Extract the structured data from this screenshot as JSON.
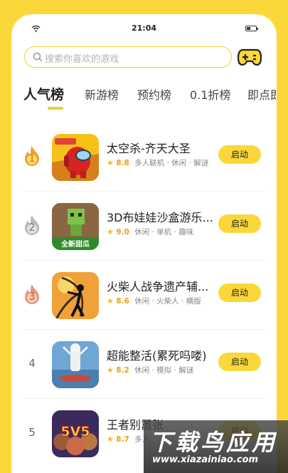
{
  "status": {
    "time": "21:04"
  },
  "search": {
    "placeholder": "搜索你喜欢的游戏"
  },
  "tabs": [
    {
      "label": "人气榜",
      "active": true
    },
    {
      "label": "新游榜"
    },
    {
      "label": "预约榜"
    },
    {
      "label": "0.1折榜"
    },
    {
      "label": "即点即"
    }
  ],
  "games": [
    {
      "rank": "1",
      "title": "太空杀-齐天大圣",
      "rating": "8.8",
      "tags": "多人联机 · 休闲 · 解谜",
      "button": "启动",
      "icon": "among-us-icon"
    },
    {
      "rank": "2",
      "title": "3D布娃娃沙盒游乐...",
      "rating": "9.0",
      "tags": "休闲 · 单机 · 趣味",
      "button": "启动",
      "icon": "ragdoll-sandbox-icon",
      "icon_caption": "全新甜瓜"
    },
    {
      "rank": "3",
      "title": "火柴人战争遗产辅...",
      "rating": "8.6",
      "tags": "休闲 · 火柴人 · 横版",
      "button": "启动",
      "icon": "stickman-archer-icon"
    },
    {
      "rank": "4",
      "title": "超能整活(累死吗喽)",
      "rating": "8.2",
      "tags": "休闲 · 模拟 · 解谜",
      "button": "启动",
      "icon": "meme-cat-icon"
    },
    {
      "rank": "5",
      "title": "王者别嚣张",
      "rating": "8.7",
      "tags": "多人",
      "button": "启动",
      "icon": "5v5-heroes-icon",
      "icon_caption": "5V5"
    }
  ],
  "watermark": {
    "title": "下载鸟应用",
    "url": "www.xiazainiao.com"
  },
  "colors": {
    "accent": "#fbd83a",
    "rank_gold": "#f2a024",
    "rank_silver": "#b8b8b8",
    "rank_bronze": "#e8967a"
  }
}
